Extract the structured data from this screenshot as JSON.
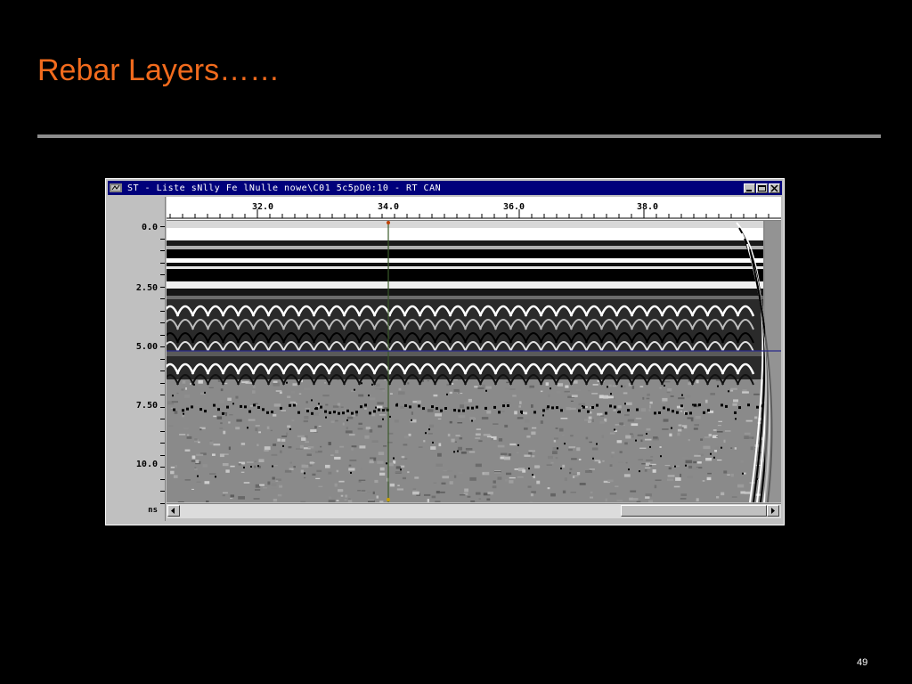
{
  "slide": {
    "title": "Rebar Layers……",
    "page_number": "49",
    "title_color": "#f26b1d",
    "background": "#000000"
  },
  "window": {
    "title": "ST - Liste  sNlly  Fe lNulle nowe\\C01 5c5pD0:10 - RT CAN",
    "app_icon": "radar-app-icon",
    "controls": [
      "minimize",
      "maximize",
      "close"
    ],
    "titlebar_color": "#00007b"
  },
  "axes": {
    "x_ticks": [
      "32.0",
      "34.0",
      "36.0",
      "38.0"
    ],
    "y_ticks": [
      "0.0",
      "2.50",
      "5.00",
      "7.50",
      "10.0"
    ],
    "y_units": "ns"
  },
  "radar_scan": {
    "description_kind": "GPR B-scan grayscale radargram with rebar hyperbolas",
    "cursor_x_value": "34.0",
    "cursor_y_value": "5.00"
  }
}
